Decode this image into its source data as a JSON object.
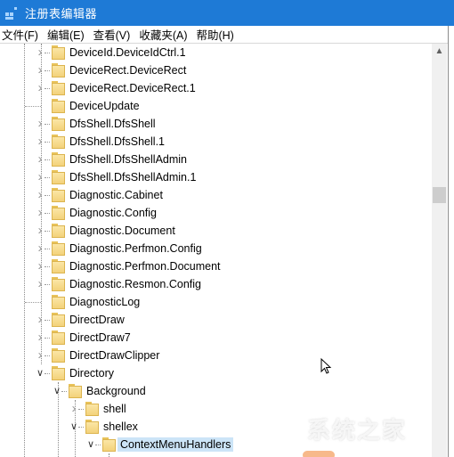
{
  "window": {
    "title": "注册表编辑器",
    "app_icon": "regedit-icon"
  },
  "menu": [
    {
      "label": "文件(F)"
    },
    {
      "label": "编辑(E)"
    },
    {
      "label": "查看(V)"
    },
    {
      "label": "收藏夹(A)"
    },
    {
      "label": "帮助(H)"
    }
  ],
  "tree": {
    "items": [
      {
        "label": "DeviceId.DeviceIdCtrl.1",
        "level": 0,
        "expander": "collapsed"
      },
      {
        "label": "DeviceRect.DeviceRect",
        "level": 0,
        "expander": "collapsed"
      },
      {
        "label": "DeviceRect.DeviceRect.1",
        "level": 0,
        "expander": "collapsed"
      },
      {
        "label": "DeviceUpdate",
        "level": 0,
        "expander": "none"
      },
      {
        "label": "DfsShell.DfsShell",
        "level": 0,
        "expander": "collapsed"
      },
      {
        "label": "DfsShell.DfsShell.1",
        "level": 0,
        "expander": "collapsed"
      },
      {
        "label": "DfsShell.DfsShellAdmin",
        "level": 0,
        "expander": "collapsed"
      },
      {
        "label": "DfsShell.DfsShellAdmin.1",
        "level": 0,
        "expander": "collapsed"
      },
      {
        "label": "Diagnostic.Cabinet",
        "level": 0,
        "expander": "collapsed"
      },
      {
        "label": "Diagnostic.Config",
        "level": 0,
        "expander": "collapsed"
      },
      {
        "label": "Diagnostic.Document",
        "level": 0,
        "expander": "collapsed"
      },
      {
        "label": "Diagnostic.Perfmon.Config",
        "level": 0,
        "expander": "collapsed"
      },
      {
        "label": "Diagnostic.Perfmon.Document",
        "level": 0,
        "expander": "collapsed"
      },
      {
        "label": "Diagnostic.Resmon.Config",
        "level": 0,
        "expander": "collapsed"
      },
      {
        "label": "DiagnosticLog",
        "level": 0,
        "expander": "none"
      },
      {
        "label": "DirectDraw",
        "level": 0,
        "expander": "collapsed"
      },
      {
        "label": "DirectDraw7",
        "level": 0,
        "expander": "collapsed"
      },
      {
        "label": "DirectDrawClipper",
        "level": 0,
        "expander": "collapsed"
      },
      {
        "label": "Directory",
        "level": 0,
        "expander": "expanded"
      },
      {
        "label": "Background",
        "level": 1,
        "expander": "expanded"
      },
      {
        "label": "shell",
        "level": 2,
        "expander": "collapsed"
      },
      {
        "label": "shellex",
        "level": 2,
        "expander": "expanded"
      },
      {
        "label": "ContextMenuHandlers",
        "level": 3,
        "expander": "expanded",
        "selected": true
      }
    ]
  },
  "scrollbar": {
    "up_arrow": "chevron-up-icon",
    "position_fraction": 0.35
  },
  "watermark": {
    "text": "系统之家"
  },
  "colors": {
    "titlebar": "#1e7ad6",
    "selection": "#cce4f7",
    "folder": "#f3d27a"
  }
}
